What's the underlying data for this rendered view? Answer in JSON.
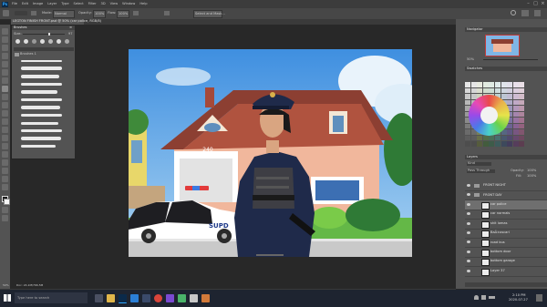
{
  "menu": {
    "items": [
      "File",
      "Edit",
      "Image",
      "Layer",
      "Type",
      "Select",
      "Filter",
      "3D",
      "View",
      "Window",
      "Help"
    ]
  },
  "options": {
    "mode_label": "Mode:",
    "mode_value": "Normal",
    "opacity_label": "Opacity:",
    "opacity_value": "100%",
    "flow_label": "Flow:",
    "flow_value": "100%",
    "select_mask": "Select and Mask..."
  },
  "document": {
    "tab_title": "LEGTON FINISH FRONT.psd @ 50% (car police, RGB/8)"
  },
  "brushes": {
    "title": "Brushes",
    "size_label": "Size:",
    "size_value": "97",
    "group": "Brushes 1"
  },
  "art": {
    "house_number": "240",
    "car_text": "SUPD"
  },
  "navigator": {
    "title": "Navigator",
    "zoom": "50%"
  },
  "swatches": {
    "title": "Swatches"
  },
  "layers": {
    "title": "Layers",
    "kind": "Kind",
    "blend": "Pass Through",
    "opacity_label": "Opacity:",
    "opacity_value": "100%",
    "fill_label": "Fill:",
    "fill_value": "100%",
    "items": [
      {
        "name": "FRONT NIGHT",
        "type": "group"
      },
      {
        "name": "FRONT DAY",
        "type": "group"
      },
      {
        "name": "car police",
        "type": "layer",
        "selected": true
      },
      {
        "name": "car normals",
        "type": "layer"
      },
      {
        "name": "shit lomas",
        "type": "layer"
      },
      {
        "name": "BaÃ±oscari",
        "type": "layer"
      },
      {
        "name": "road bus",
        "type": "layer"
      },
      {
        "name": "bottom door",
        "type": "layer"
      },
      {
        "name": "bottom garage",
        "type": "layer"
      },
      {
        "name": "Layer 37",
        "type": "layer"
      }
    ]
  },
  "status": {
    "zoom": "50%",
    "doc": "Doc: 24,1M/766,5M"
  },
  "taskbar": {
    "search": "Type here to search",
    "time": "2:10 PM",
    "date": "2020-07-27"
  },
  "colors": {
    "accent": "#1473e6",
    "taskbar": "#1e2430",
    "panel": "#535353"
  }
}
